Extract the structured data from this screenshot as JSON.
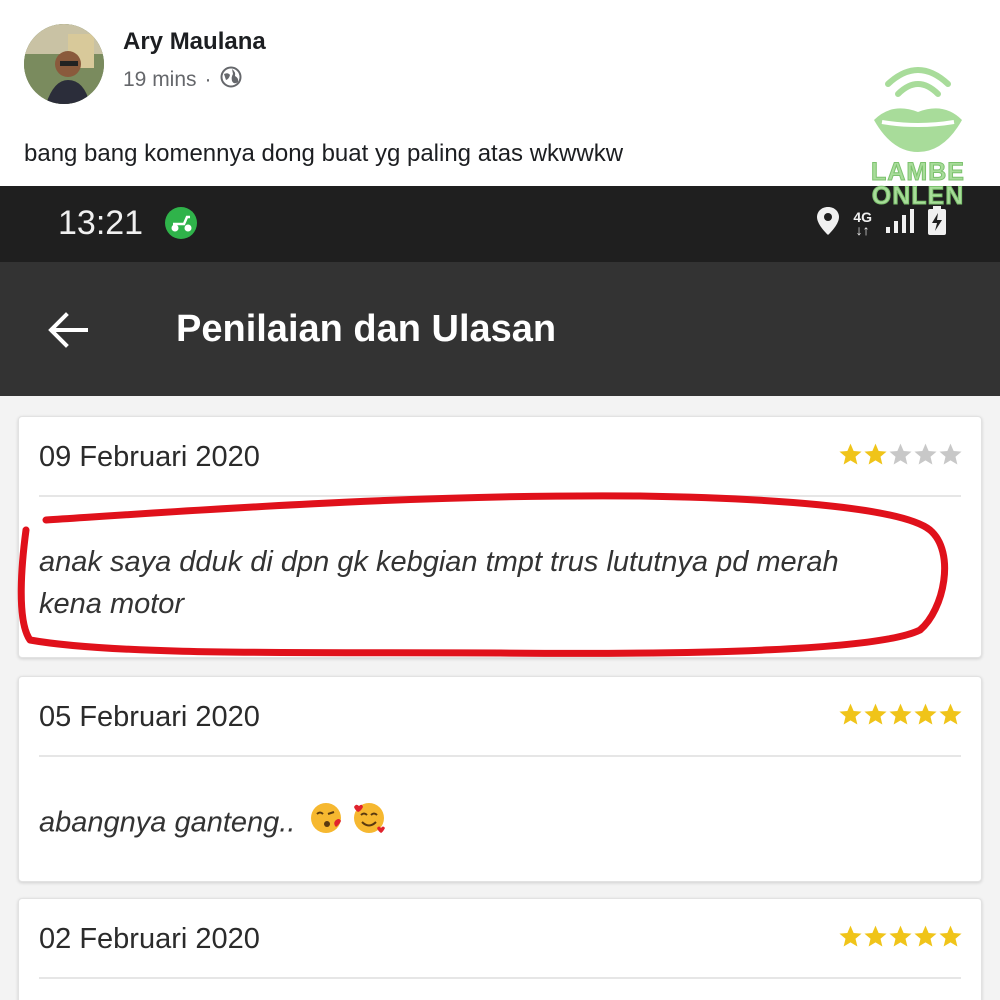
{
  "post": {
    "author": "Ary Maulana",
    "time": "19 mins",
    "separator": "·",
    "privacy_icon": "globe-icon",
    "text": "bang bang komennya dong buat yg paling atas wkwwkw"
  },
  "watermark": {
    "line1": "LAMBE",
    "line2": "ONLEN",
    "color": "#a8dc9a"
  },
  "status_bar": {
    "time": "13:21",
    "network": [
      "4G",
      "↓↑"
    ],
    "icons": [
      "scooter-app-icon",
      "location-icon",
      "signal-icon",
      "battery-charging-icon"
    ]
  },
  "app_bar": {
    "title": "Penilaian dan Ulasan",
    "back_icon": "arrow-left-icon"
  },
  "reviews": [
    {
      "date": "09 Februari 2020",
      "rating": 2,
      "max": 5,
      "text_line1": "anak saya dduk di dpn gk kebgian tmpt trus lututnya pd merah",
      "text_line2": "kena motor",
      "highlighted": true
    },
    {
      "date": "05 Februari 2020",
      "rating": 5,
      "max": 5,
      "text_line1": "abangnya ganteng..",
      "emojis": [
        "kissing-face-emoji",
        "smiling-face-with-hearts-emoji"
      ]
    },
    {
      "date": "02 Februari 2020",
      "rating": 5,
      "max": 5
    }
  ],
  "colors": {
    "star_filled": "#f0c419",
    "star_empty": "#c8c8c8",
    "highlight_stroke": "#e0111b",
    "app_bar": "#333333",
    "status_bar": "#1f1f1f"
  }
}
